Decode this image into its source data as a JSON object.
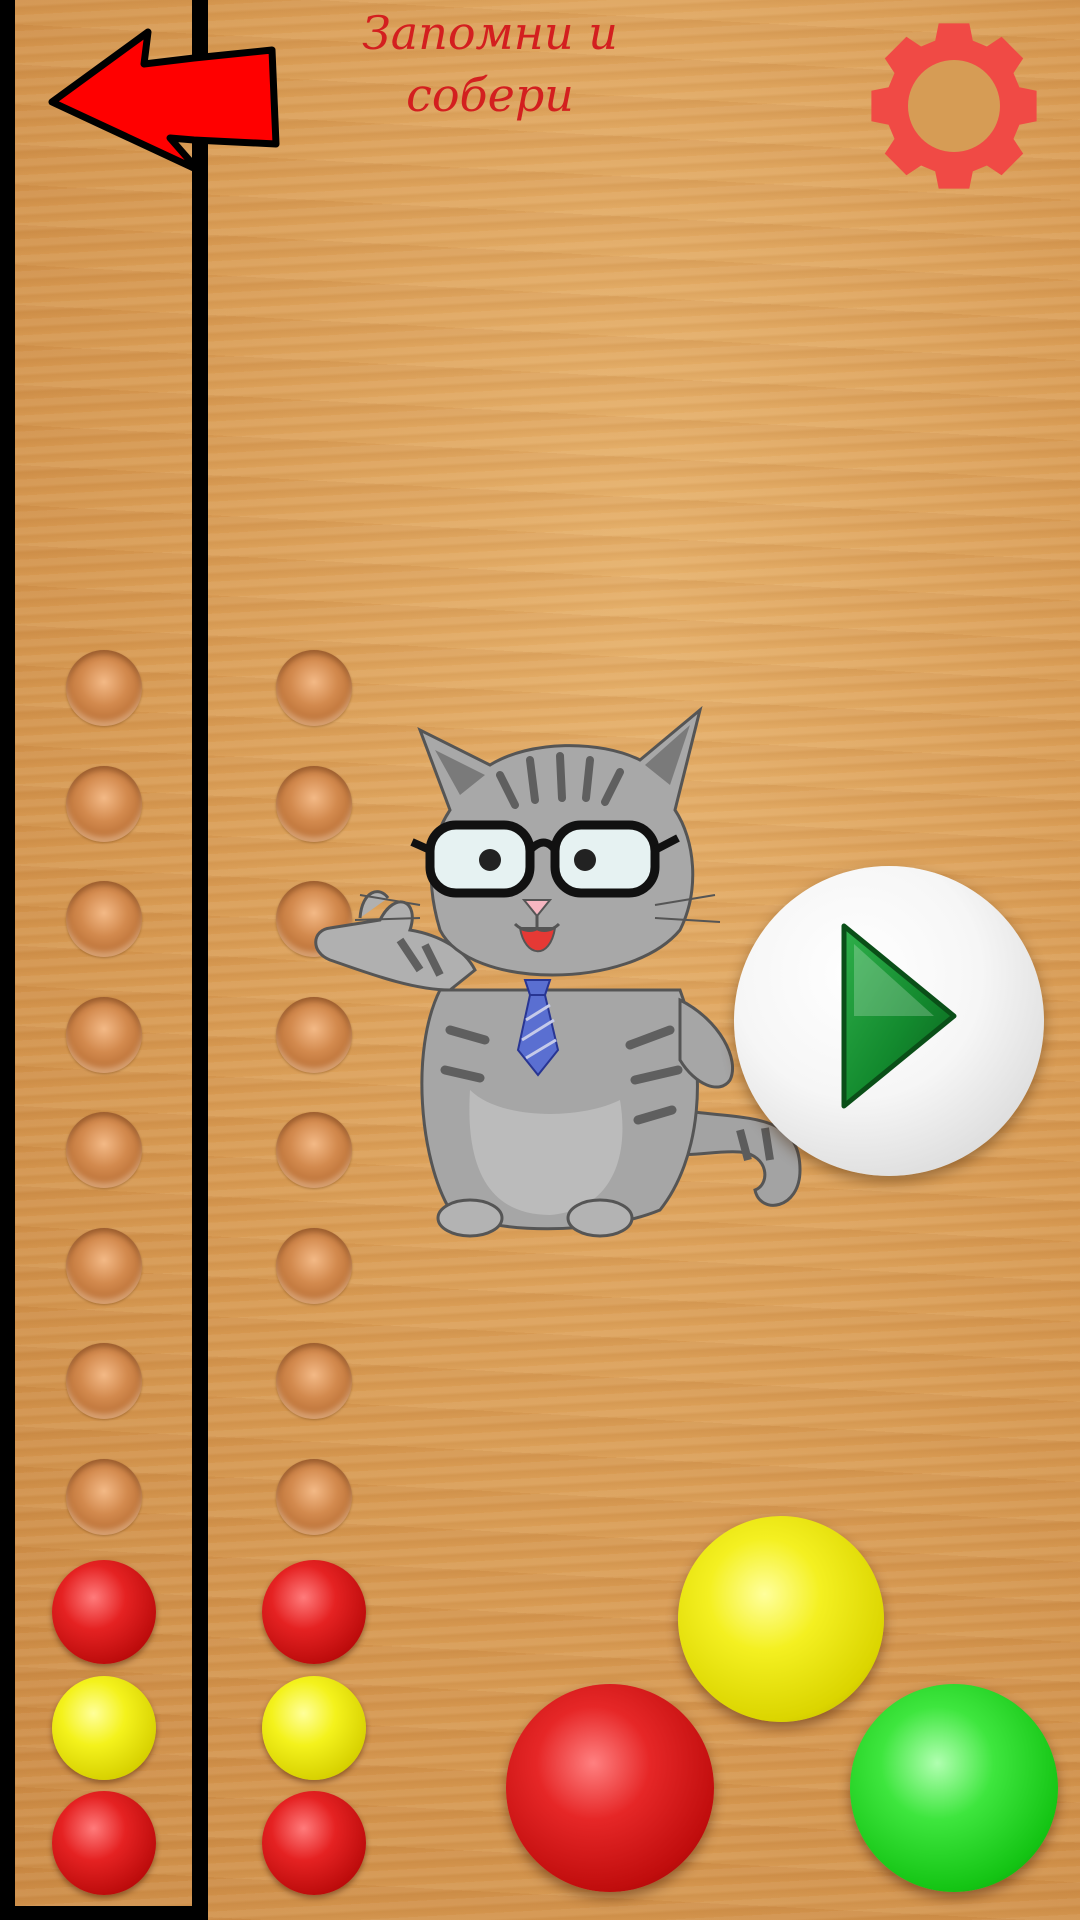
{
  "header": {
    "title_line1": "Запомни  и",
    "title_line2": "собери"
  },
  "icons": {
    "back": "back-arrow-icon",
    "settings": "gear-icon",
    "play": "play-icon",
    "mascot": "cat-mascot"
  },
  "colors": {
    "arrow": "#ff0000",
    "gear": "#f04a45",
    "title": "#d31f1f",
    "play": "#1f9a38"
  },
  "board": {
    "columns": [
      {
        "name": "sample",
        "slots": [
          "empty",
          "empty",
          "empty",
          "empty",
          "empty",
          "empty",
          "empty",
          "empty",
          "red",
          "yellow",
          "red"
        ]
      },
      {
        "name": "player",
        "slots": [
          "empty",
          "empty",
          "empty",
          "empty",
          "empty",
          "empty",
          "empty",
          "empty",
          "red",
          "yellow",
          "red"
        ]
      }
    ]
  },
  "palette": [
    "yellow",
    "red",
    "green"
  ]
}
